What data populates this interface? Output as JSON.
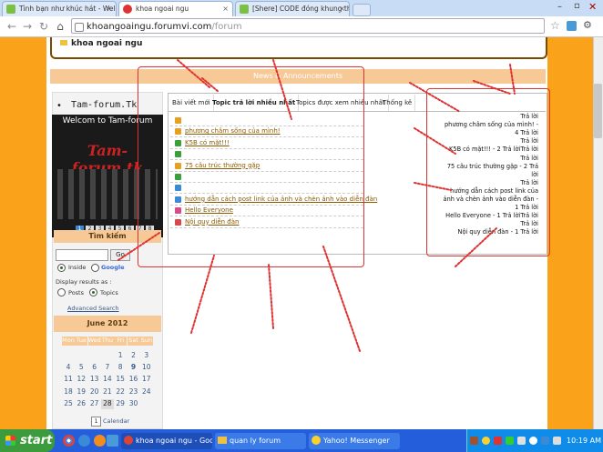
{
  "browser": {
    "tabs": [
      {
        "title": "Tình bạn như khúc hát - Welco",
        "active": false
      },
      {
        "title": "khoa ngoai ngu",
        "active": true
      },
      {
        "title": "[Shere] CODE đóng khung thư",
        "active": false
      }
    ],
    "address": {
      "host": "khoangoaingu.forumvi.com",
      "path": "/forum"
    }
  },
  "page": {
    "forum_title": "khoa ngoai ngu",
    "news_header": "News & Announcements",
    "sidebar": {
      "list_item": "Tam-forum.Tk",
      "slideshow_title": "Welcom to Tam-forum",
      "slideshow_pages": [
        "1",
        "2",
        "3",
        "4",
        "5",
        "6",
        "7",
        "8"
      ],
      "search": {
        "header": "Tìm kiếm",
        "go_label": "Go",
        "inside_label": "Inside",
        "google_label": "Google",
        "display_label": "Display results as :",
        "posts_label": "Posts",
        "topics_label": "Topics",
        "advanced_label": "Advanced Search"
      },
      "calendar": {
        "header": "June 2012",
        "days": [
          "Mon",
          "Tue",
          "Wed",
          "Thu",
          "Fri",
          "Sat",
          "Sun"
        ],
        "weeks": [
          [
            "",
            "",
            "",
            "",
            "1",
            "2",
            "3"
          ],
          [
            "4",
            "5",
            "6",
            "7",
            "8",
            "9",
            "10"
          ],
          [
            "11",
            "12",
            "13",
            "14",
            "15",
            "16",
            "17"
          ],
          [
            "18",
            "19",
            "20",
            "21",
            "22",
            "23",
            "24"
          ],
          [
            "25",
            "26",
            "27",
            "28",
            "29",
            "30",
            ""
          ]
        ],
        "today": "28",
        "footer": "Calendar"
      }
    },
    "panel": {
      "tabs": [
        "Bài viết mới",
        "Topic trả lời nhiều nhất",
        "Topics được xem nhiều nhất",
        "Thống kê"
      ],
      "active_tab": 1,
      "topics": [
        {
          "title": "",
          "icon_color": "#e8a020"
        },
        {
          "title": "phương châm sống của mình!",
          "icon_color": "#e8a020"
        },
        {
          "title": "K5B có mặt!!!",
          "icon_color": "#3aa03a"
        },
        {
          "title": "",
          "icon_color": "#3aa03a"
        },
        {
          "title": "75 câu trúc thường gặp",
          "icon_color": "#e8a020"
        },
        {
          "title": "",
          "icon_color": "#3aa03a"
        },
        {
          "title": "",
          "icon_color": "#3a8ad8"
        },
        {
          "title": "hướng dẫn cách post link của ảnh và chèn ảnh vào diễn đàn",
          "icon_color": "#3a8ad8"
        },
        {
          "title": "Hello Everyone",
          "icon_color": "#d84a8a"
        },
        {
          "title": "Nội quy diễn đàn",
          "icon_color": "#d84a4a"
        }
      ],
      "reply_lines": [
        "Trả lời",
        "phương châm sống của mình! -",
        "4 Trả lời",
        "Trả lời",
        "K5B có mặt!!! - 2 Trả lờiTrả lời",
        "Trả lời",
        "75 câu trúc thường gặp - 2 Trả",
        "lời",
        "Trả lời",
        "hướng dẫn cách post link của",
        "ảnh và chèn ảnh vào diễn đàn -",
        "1 Trả lời",
        "Hello Everyone - 1 Trả lờiTrả lời",
        "Trả lời",
        "Nội quy diễn đàn - 1 Trả lời"
      ]
    }
  },
  "taskbar": {
    "start_label": "start",
    "tasks": [
      {
        "label": "khoa ngoai ngu - Goo...",
        "active": true
      },
      {
        "label": "quan ly forum",
        "active": false
      },
      {
        "label": "Yahoo! Messenger",
        "active": false
      }
    ],
    "clock": "10:19 AM"
  }
}
